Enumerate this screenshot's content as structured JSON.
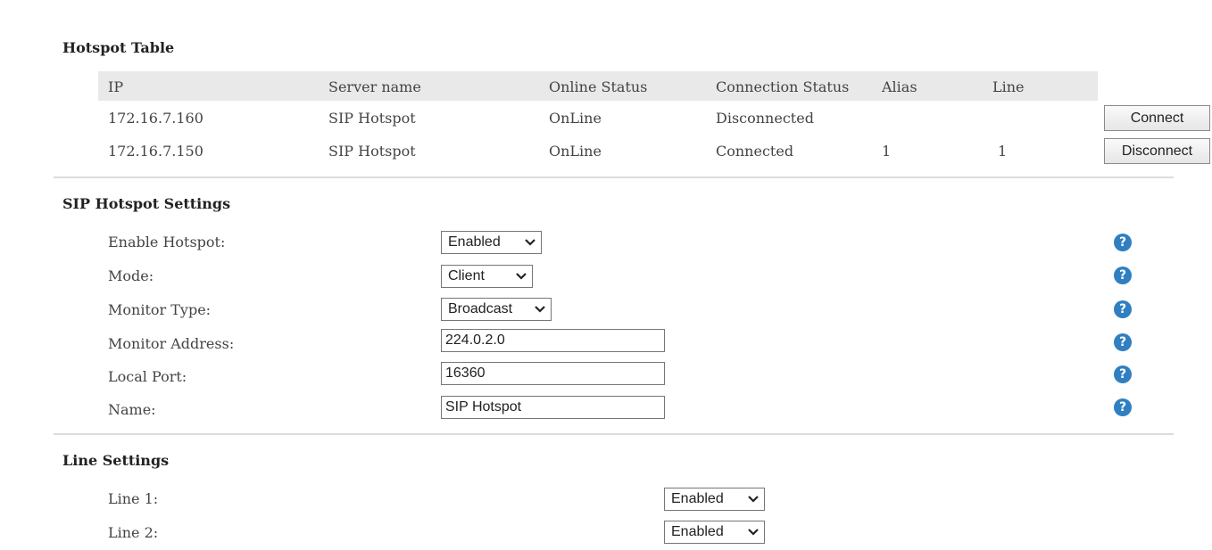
{
  "hotspot_table": {
    "title": "Hotspot Table",
    "columns": [
      "IP",
      "Server name",
      "Online Status",
      "Connection Status",
      "Alias",
      "Line"
    ],
    "rows": [
      {
        "ip": "172.16.7.160",
        "server_name": "SIP Hotspot",
        "online_status": "OnLine",
        "connection_status": "Disconnected",
        "alias": "",
        "line": "",
        "action": "Connect"
      },
      {
        "ip": "172.16.7.150",
        "server_name": "SIP Hotspot",
        "online_status": "OnLine",
        "connection_status": "Connected",
        "alias": "1",
        "line": "1",
        "action": "Disconnect"
      }
    ]
  },
  "sip_hotspot_settings": {
    "title": "SIP Hotspot Settings",
    "enable_hotspot": {
      "label": "Enable Hotspot:",
      "value": "Enabled"
    },
    "mode": {
      "label": "Mode:",
      "value": "Client"
    },
    "monitor_type": {
      "label": "Monitor Type:",
      "value": "Broadcast"
    },
    "monitor_address": {
      "label": "Monitor Address:",
      "value": "224.0.2.0"
    },
    "local_port": {
      "label": "Local Port:",
      "value": "16360"
    },
    "name": {
      "label": "Name:",
      "value": "SIP Hotspot"
    }
  },
  "line_settings": {
    "title": "Line Settings",
    "line1": {
      "label": "Line 1:",
      "value": "Enabled"
    },
    "line2": {
      "label": "Line 2:",
      "value": "Enabled"
    }
  },
  "colors": {
    "help_icon": "#2f7fc1",
    "header_bg": "#e9e9e9",
    "divider": "#dcdcdc"
  }
}
